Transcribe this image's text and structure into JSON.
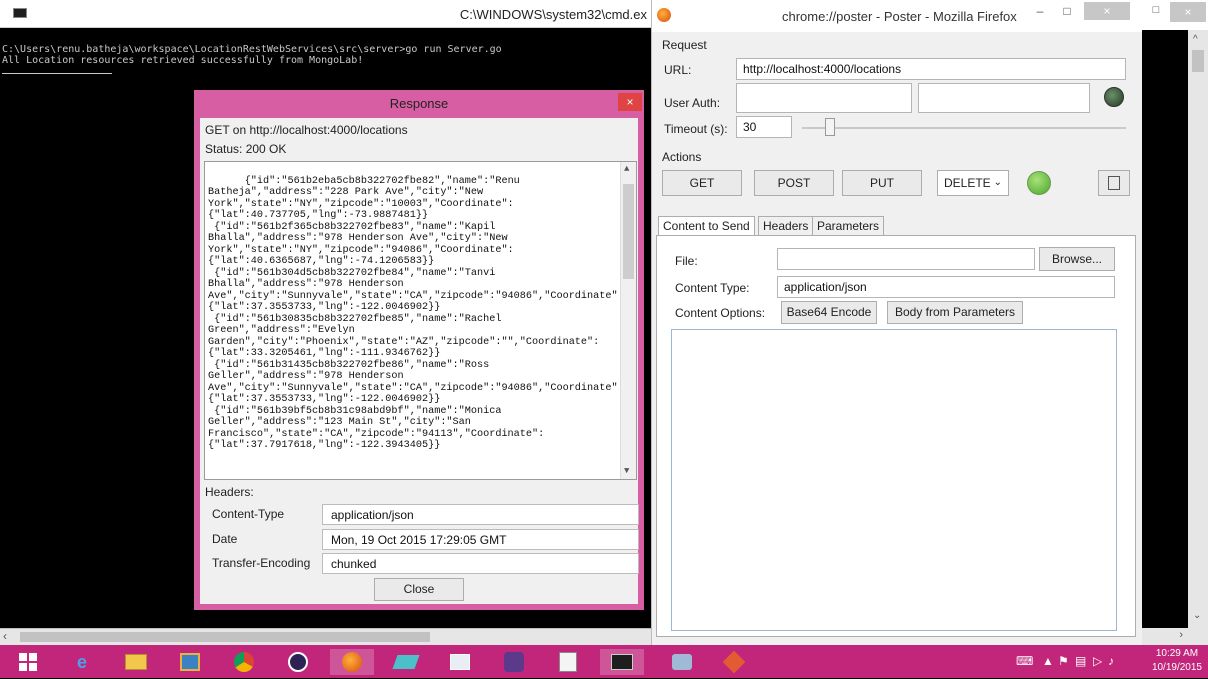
{
  "cmd": {
    "title": "C:\\WINDOWS\\system32\\cmd.ex",
    "lines": [
      "C:\\Users\\renu.batheja\\workspace\\LocationRestWebServices\\src\\server>go run Server.go",
      "All Location resources retrieved successfully from MongoLab!"
    ]
  },
  "response": {
    "title": "Response",
    "close_x": "×",
    "request_line": "GET on http://localhost:4000/locations",
    "status": "Status:  200 OK",
    "body": "{\"id\":\"561b2eba5cb8b322702fbe82\",\"name\":\"Renu Batheja\",\"address\":\"228 Park Ave\",\"city\":\"New York\",\"state\":\"NY\",\"zipcode\":\"10003\",\"Coordinate\":{\"lat\":40.737705,\"lng\":-73.9887481}}\n {\"id\":\"561b2f365cb8b322702fbe83\",\"name\":\"Kapil Bhalla\",\"address\":\"978 Henderson Ave\",\"city\":\"New York\",\"state\":\"NY\",\"zipcode\":\"94086\",\"Coordinate\":{\"lat\":40.6365687,\"lng\":-74.1206583}}\n {\"id\":\"561b304d5cb8b322702fbe84\",\"name\":\"Tanvi Bhalla\",\"address\":\"978 Henderson Ave\",\"city\":\"Sunnyvale\",\"state\":\"CA\",\"zipcode\":\"94086\",\"Coordinate\":{\"lat\":37.3553733,\"lng\":-122.0046902}}\n {\"id\":\"561b30835cb8b322702fbe85\",\"name\":\"Rachel Green\",\"address\":\"Evelyn Garden\",\"city\":\"Phoenix\",\"state\":\"AZ\",\"zipcode\":\"\",\"Coordinate\":{\"lat\":33.3205461,\"lng\":-111.9346762}}\n {\"id\":\"561b31435cb8b322702fbe86\",\"name\":\"Ross Geller\",\"address\":\"978 Henderson Ave\",\"city\":\"Sunnyvale\",\"state\":\"CA\",\"zipcode\":\"94086\",\"Coordinate\":{\"lat\":37.3553733,\"lng\":-122.0046902}}\n {\"id\":\"561b39bf5cb8b31c98abd9bf\",\"name\":\"Monica Geller\",\"address\":\"123 Main St\",\"city\":\"San Francisco\",\"state\":\"CA\",\"zipcode\":\"94113\",\"Coordinate\":{\"lat\":37.7917618,\"lng\":-122.3943405}}",
    "headers_label": "Headers:",
    "headers": [
      {
        "key": "Content-Type",
        "value": "application/json"
      },
      {
        "key": "Date",
        "value": "Mon, 19 Oct 2015 17:29:05 GMT"
      },
      {
        "key": "Transfer-Encoding",
        "value": "chunked"
      }
    ],
    "close_label": "Close"
  },
  "firefox": {
    "title": "chrome://poster - Poster - Mozilla Firefox",
    "win_min": "–",
    "win_max": "□",
    "win_close": "×",
    "request_label": "Request",
    "url_label": "URL:",
    "url_value": "http://localhost:4000/locations",
    "user_auth_label": "User Auth:",
    "timeout_label": "Timeout (s):",
    "timeout_value": "30",
    "actions_label": "Actions",
    "actions": [
      "GET",
      "POST",
      "PUT"
    ],
    "delete_select": "DELETE",
    "tabs": [
      "Content to Send",
      "Headers",
      "Parameters"
    ],
    "file_label": "File:",
    "browse_label": "Browse...",
    "content_type_label": "Content Type:",
    "content_type_value": "application/json",
    "content_options_label": "Content Options:",
    "base64_label": "Base64 Encode",
    "body_from_params_label": "Body from Parameters"
  },
  "taskbar": {
    "time": "10:29 AM",
    "date": "10/19/2015"
  },
  "colors": {
    "taskbar": "#c1267a",
    "dialog_frame": "#d85ea3",
    "close_red": "#e04343"
  }
}
